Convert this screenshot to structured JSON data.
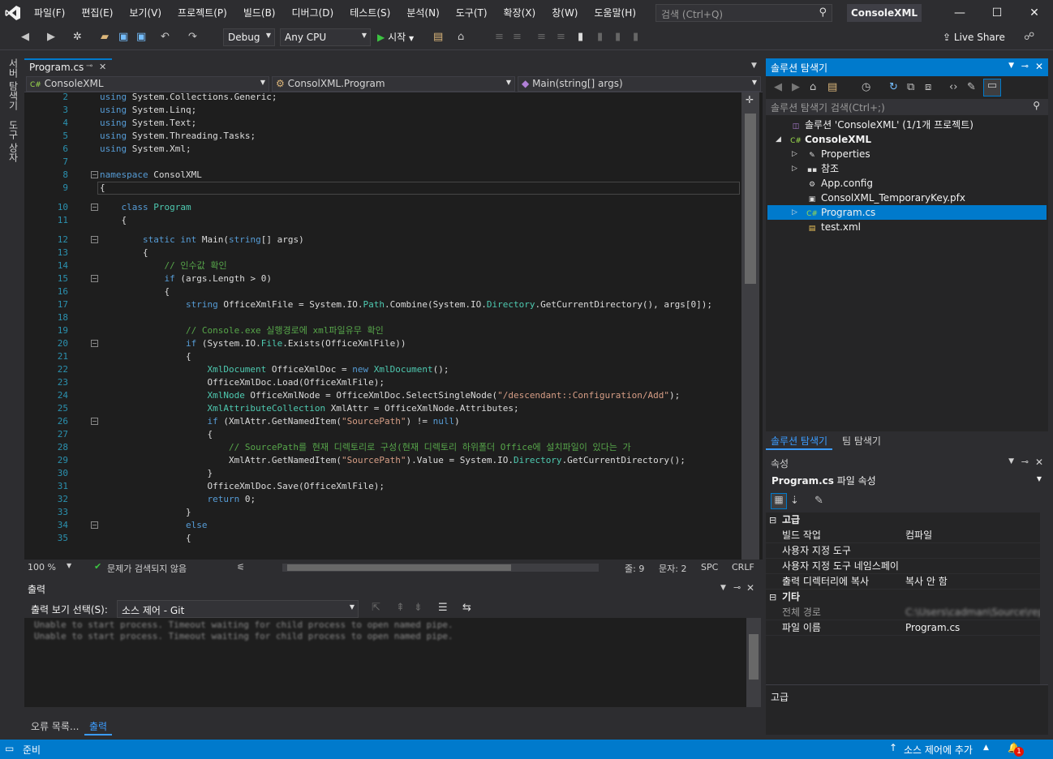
{
  "menu": [
    "파일(F)",
    "편집(E)",
    "보기(V)",
    "프로젝트(P)",
    "빌드(B)",
    "디버그(D)",
    "테스트(S)",
    "분석(N)",
    "도구(T)",
    "확장(X)",
    "창(W)",
    "도움말(H)"
  ],
  "search": {
    "placeholder": "검색 (Ctrl+Q)"
  },
  "app_title": "ConsoleXML",
  "toolbar": {
    "config": "Debug",
    "platform": "Any CPU",
    "start": "시작",
    "liveshare": "Live Share"
  },
  "left_tabs": {
    "server": "서버 탐색기",
    "toolbox": "도구 상자"
  },
  "doc_tab": {
    "name": "Program.cs"
  },
  "nav": {
    "project": "ConsoleXML",
    "class": "ConsolXML.Program",
    "member": "Main(string[] args)"
  },
  "code_lines": [
    {
      "n": "2",
      "t": "using System.Collections.Generic;"
    },
    {
      "n": "3",
      "t": "using System.Linq;"
    },
    {
      "n": "4",
      "t": "using System.Text;"
    },
    {
      "n": "5",
      "t": "using System.Threading.Tasks;"
    },
    {
      "n": "6",
      "t": "using System.Xml;"
    },
    {
      "n": "7",
      "t": ""
    },
    {
      "n": "8",
      "t": "namespace ConsolXML"
    },
    {
      "n": "9",
      "t": "{"
    },
    {
      "n": "10",
      "t": "    class Program"
    },
    {
      "n": "11",
      "t": "    {"
    },
    {
      "n": "12",
      "t": "        static int Main(string[] args)"
    },
    {
      "n": "13",
      "t": "        {"
    },
    {
      "n": "14",
      "t": "            // 인수값 확인"
    },
    {
      "n": "15",
      "t": "            if (args.Length > 0)"
    },
    {
      "n": "16",
      "t": "            {"
    },
    {
      "n": "17",
      "t": "                string OfficeXmlFile = System.IO.Path.Combine(System.IO.Directory.GetCurrentDirectory(), args[0]);"
    },
    {
      "n": "18",
      "t": ""
    },
    {
      "n": "19",
      "t": "                // Console.exe 실행경로에 xml파일유무 확인"
    },
    {
      "n": "20",
      "t": "                if (System.IO.File.Exists(OfficeXmlFile))"
    },
    {
      "n": "21",
      "t": "                {"
    },
    {
      "n": "22",
      "t": "                    XmlDocument OfficeXmlDoc = new XmlDocument();"
    },
    {
      "n": "23",
      "t": "                    OfficeXmlDoc.Load(OfficeXmlFile);"
    },
    {
      "n": "24",
      "t": "                    XmlNode OfficeXmlNode = OfficeXmlDoc.SelectSingleNode(\"/descendant::Configuration/Add\");"
    },
    {
      "n": "25",
      "t": "                    XmlAttributeCollection XmlAttr = OfficeXmlNode.Attributes;"
    },
    {
      "n": "26",
      "t": "                    if (XmlAttr.GetNamedItem(\"SourcePath\") != null)"
    },
    {
      "n": "27",
      "t": "                    {"
    },
    {
      "n": "28",
      "t": "                        // SourcePath를 현재 디렉토리로 구성(현재 디렉토리 하위폴더 Office에 설치파일이 있다는 가"
    },
    {
      "n": "29",
      "t": "                        XmlAttr.GetNamedItem(\"SourcePath\").Value = System.IO.Directory.GetCurrentDirectory();"
    },
    {
      "n": "30",
      "t": "                    }"
    },
    {
      "n": "31",
      "t": "                    OfficeXmlDoc.Save(OfficeXmlFile);"
    },
    {
      "n": "32",
      "t": "                    return 0;"
    },
    {
      "n": "33",
      "t": "                }"
    },
    {
      "n": "34",
      "t": "                else"
    },
    {
      "n": "35",
      "t": "                {"
    }
  ],
  "editor_status": {
    "zoom": "100 %",
    "issues": "문제가 검색되지 않음",
    "line": "줄: 9",
    "col": "문자: 2",
    "spc": "SPC",
    "crlf": "CRLF"
  },
  "output": {
    "title": "출력",
    "show_label": "출력 보기 선택(S):",
    "source": "소스 제어 - Git",
    "lines": [
      "Unable to start process. Timeout waiting for child process to open named pipe.",
      "Unable to start process. Timeout waiting for child process to open named pipe."
    ]
  },
  "bottom_tabs": [
    "오류 목록...",
    "출력"
  ],
  "statusbar": {
    "ready": "준비",
    "source_control": "소스 제어에 추가",
    "notif": "1"
  },
  "solution_explorer": {
    "title": "솔루션 탐색기",
    "search": "솔루션 탐색기 검색(Ctrl+;)",
    "items": [
      {
        "label": "솔루션 'ConsoleXML' (1/1개 프로젝트)",
        "icon": "solution-icon"
      },
      {
        "label": "ConsoleXML",
        "icon": "csharp-project-icon"
      },
      {
        "label": "Properties",
        "icon": "wrench-icon"
      },
      {
        "label": "참조",
        "icon": "references-icon"
      },
      {
        "label": "App.config",
        "icon": "config-icon"
      },
      {
        "label": "ConsolXML_TemporaryKey.pfx",
        "icon": "certificate-icon"
      },
      {
        "label": "Program.cs",
        "icon": "csharp-file-icon"
      },
      {
        "label": "test.xml",
        "icon": "xml-file-icon"
      }
    ],
    "tabs": [
      "솔루션 탐색기",
      "팀 탐색기"
    ]
  },
  "properties": {
    "title": "속성",
    "selected_bold": "Program.cs",
    "selected_rest": " 파일 속성",
    "rows": [
      {
        "cat": true,
        "k": "고급",
        "v": ""
      },
      {
        "cat": false,
        "k": "빌드 작업",
        "v": "컴파일"
      },
      {
        "cat": false,
        "k": "사용자 지정 도구",
        "v": ""
      },
      {
        "cat": false,
        "k": "사용자 지정 도구 네임스페이",
        "v": ""
      },
      {
        "cat": false,
        "k": "출력 디렉터리에 복사",
        "v": "복사 안 함"
      },
      {
        "cat": true,
        "k": "기타",
        "v": ""
      },
      {
        "cat": false,
        "k": "전체 경로",
        "v": "C:\\Users\\cadman\\Source\\repos"
      },
      {
        "cat": false,
        "k": "파일 이름",
        "v": "Program.cs"
      }
    ],
    "description": "고급"
  }
}
